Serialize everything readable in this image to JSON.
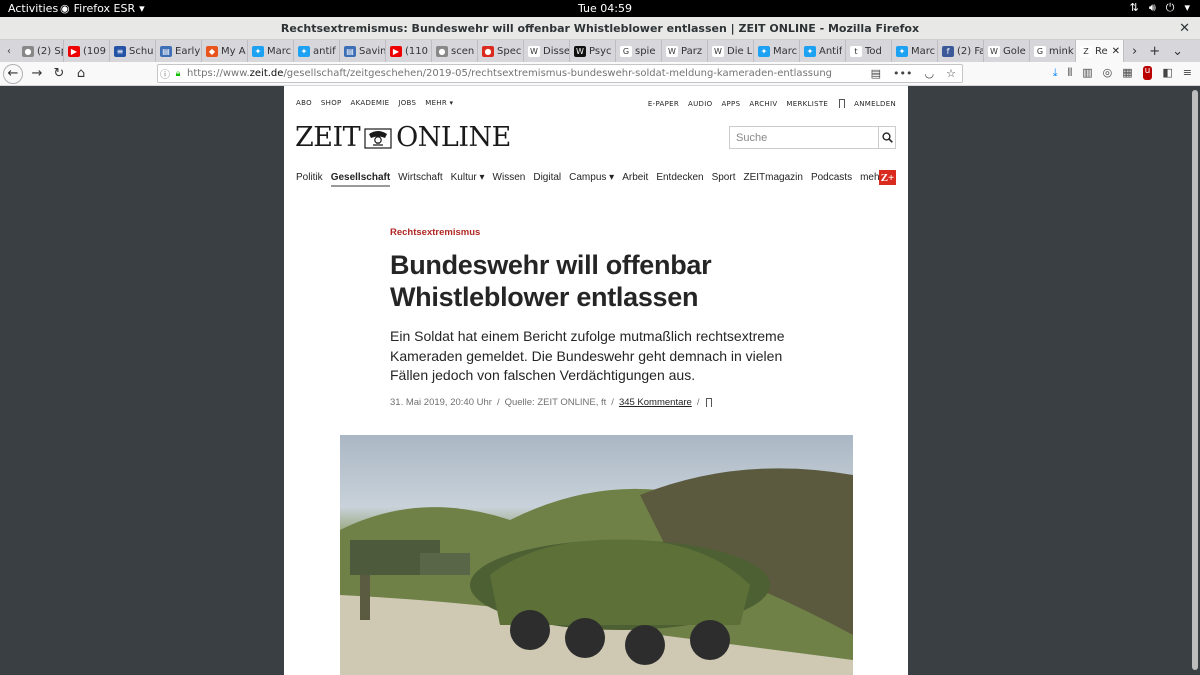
{
  "system": {
    "activities": "Activities",
    "app_menu": "Firefox ESR",
    "clock": "Tue 04:59"
  },
  "window": {
    "title": "Rechtsextremismus: Bundeswehr will offenbar Whistleblower entlassen | ZEIT ONLINE - Mozilla Firefox"
  },
  "tabs": [
    {
      "label": "(2) Sp",
      "icon": "grey"
    },
    {
      "label": "(109",
      "icon": "youtube"
    },
    {
      "label": "Schu",
      "icon": "flag"
    },
    {
      "label": "Early",
      "icon": "doc"
    },
    {
      "label": "My A",
      "icon": "orange"
    },
    {
      "label": "Marc",
      "icon": "twitter"
    },
    {
      "label": "antif",
      "icon": "twitter"
    },
    {
      "label": "Savin",
      "icon": "doc"
    },
    {
      "label": "(110",
      "icon": "youtube"
    },
    {
      "label": "scen",
      "icon": "grey"
    },
    {
      "label": "Spec",
      "icon": "red"
    },
    {
      "label": "Disse",
      "icon": "wiki"
    },
    {
      "label": "Psyc",
      "icon": "black"
    },
    {
      "label": "spie",
      "icon": "google"
    },
    {
      "label": "Parz",
      "icon": "wiki"
    },
    {
      "label": "Die L",
      "icon": "wiki"
    },
    {
      "label": "Marc",
      "icon": "twitter"
    },
    {
      "label": "Antif",
      "icon": "twitter"
    },
    {
      "label": "Tod",
      "icon": "tumblr"
    },
    {
      "label": "Marc",
      "icon": "twitter"
    },
    {
      "label": "(2) Fa",
      "icon": "facebook"
    },
    {
      "label": "Gole",
      "icon": "wiki"
    },
    {
      "label": "mink",
      "icon": "google"
    },
    {
      "label": "Re",
      "icon": "zeit",
      "active": true
    }
  ],
  "navbar": {
    "url_prefix": "https://www.",
    "url_domain": "zeit.de",
    "url_path": "/gesellschaft/zeitgeschehen/2019-05/rechtsextremismus-bundeswehr-soldat-meldung-kameraden-entlassung"
  },
  "site": {
    "meta_left": [
      "ABO",
      "SHOP",
      "AKADEMIE",
      "JOBS",
      "MEHR ▾"
    ],
    "meta_right": [
      "E-PAPER",
      "AUDIO",
      "APPS",
      "ARCHIV",
      "MERKLISTE",
      "ANMELDEN"
    ],
    "logo_left": "ZEIT",
    "logo_right": "ONLINE",
    "search_placeholder": "Suche",
    "nav": [
      {
        "label": "Politik"
      },
      {
        "label": "Gesellschaft",
        "active": true
      },
      {
        "label": "Wirtschaft"
      },
      {
        "label": "Kultur ▾"
      },
      {
        "label": "Wissen"
      },
      {
        "label": "Digital"
      },
      {
        "label": "Campus ▾"
      },
      {
        "label": "Arbeit"
      },
      {
        "label": "Entdecken"
      },
      {
        "label": "Sport"
      },
      {
        "label": "ZEITmagazin"
      },
      {
        "label": "Podcasts"
      },
      {
        "label": "mehr ▾"
      }
    ],
    "zplus": "Z+"
  },
  "article": {
    "kicker": "Rechtsextremismus",
    "headline": "Bundeswehr will offenbar Whistleblower entlassen",
    "teaser": "Ein Soldat hat einem Bericht zufolge mutmaßlich rechtsextreme Kameraden gemeldet. Die Bundeswehr geht demnach in vielen Fällen jedoch von falschen Verdächtigungen aus.",
    "date": "31. Mai 2019, 20:40 Uhr",
    "source": "Quelle: ZEIT ONLINE, ft",
    "comments": "345 Kommentare",
    "sep": "/"
  },
  "colors": {
    "kicker": "#b02824",
    "zplus": "#d92b1e"
  }
}
